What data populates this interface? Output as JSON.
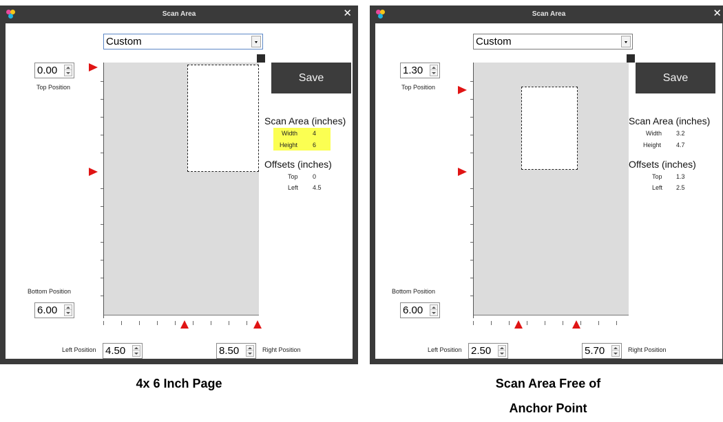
{
  "windows": [
    {
      "title": "Scan Area",
      "preset": "Custom",
      "top_position_value": "0.00",
      "top_position_label": "Top Position",
      "bottom_position_label": "Bottom Position",
      "bottom_position_value": "6.00",
      "left_position_label": "Left Position",
      "left_position_value": "4.50",
      "right_position_value": "8.50",
      "right_position_label": "Right Position",
      "save_label": "Save",
      "scan_area_heading": "Scan Area (inches)",
      "width_label": "Width",
      "width_value": "4",
      "height_label": "Height",
      "height_value": "6",
      "offsets_heading": "Offsets (inches)",
      "offset_top_label": "Top",
      "offset_top_value": "0",
      "offset_left_label": "Left",
      "offset_left_value": "4.5",
      "highlight_color": "#fbff52"
    },
    {
      "title": "Scan Area",
      "preset": "Custom",
      "top_position_value": "1.30",
      "top_position_label": "Top Position",
      "bottom_position_label": "Bottom Position",
      "bottom_position_value": "6.00",
      "left_position_label": "Left Position",
      "left_position_value": "2.50",
      "right_position_value": "5.70",
      "right_position_label": "Right Position",
      "save_label": "Save",
      "scan_area_heading": "Scan Area (inches)",
      "width_label": "Width",
      "width_value": "3.2",
      "height_label": "Height",
      "height_value": "4.7",
      "offsets_heading": "Offsets (inches)",
      "offset_top_label": "Top",
      "offset_top_value": "1.3",
      "offset_left_label": "Left",
      "offset_left_value": "2.5"
    }
  ],
  "captions": {
    "left": "4x 6 Inch Page",
    "right_line1": "Scan Area Free of",
    "right_line2": "Anchor Point"
  },
  "icons": {
    "app": "app-logo-icon",
    "close": "close-icon",
    "marker": "red-triangle-marker-icon",
    "anchor": "anchor-point-icon"
  },
  "colors": {
    "marker": "#e01414",
    "titlebar": "#3a3a3a",
    "canvas": "#dcdcdc"
  }
}
